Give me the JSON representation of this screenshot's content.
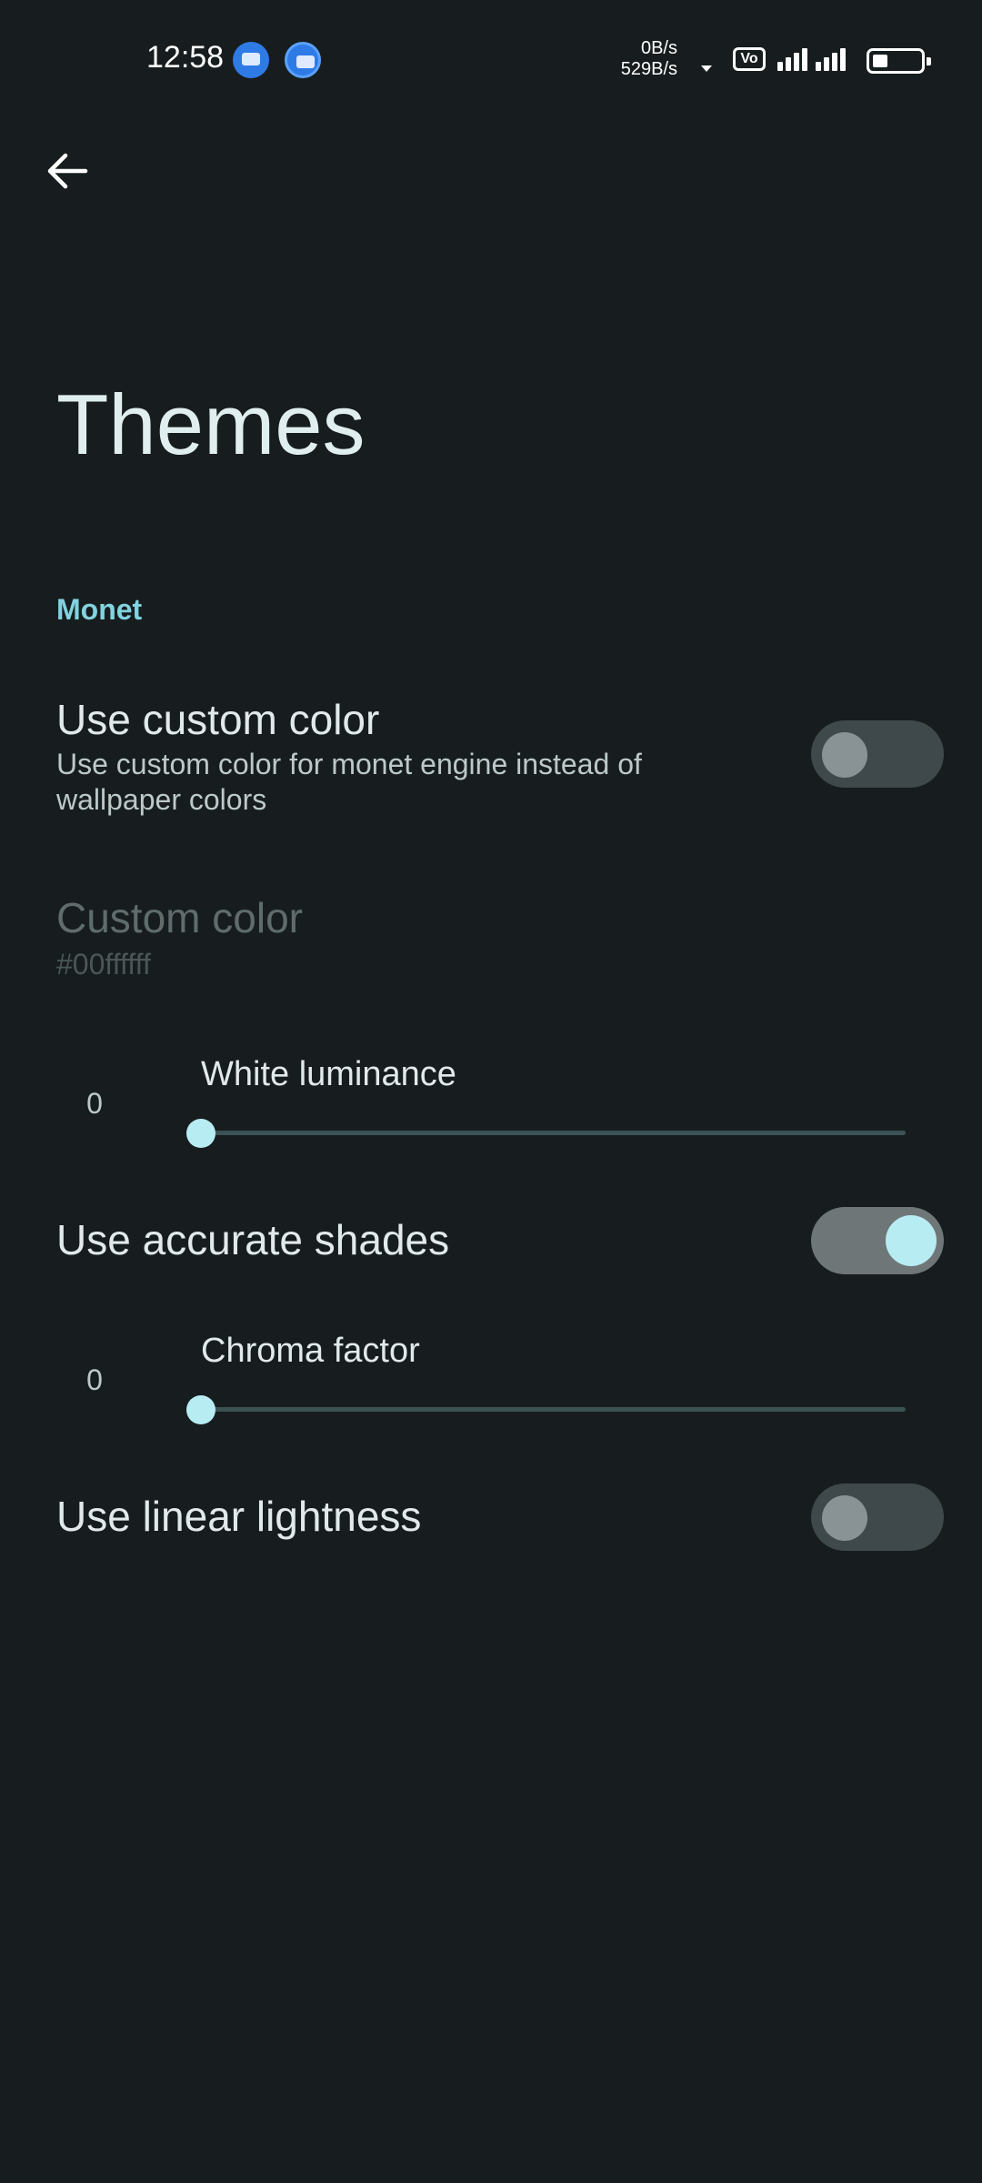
{
  "status_bar": {
    "time": "12:58",
    "net_up": "0B/s",
    "net_down": "529B/s",
    "volte": "Vo",
    "icons": [
      "message-notification-icon",
      "message-notification-icon",
      "wifi-activity-icon",
      "volte-icon",
      "signal-icon",
      "signal-icon",
      "battery-icon"
    ]
  },
  "app_bar": {
    "back_icon": "arrow-back-icon"
  },
  "page": {
    "title": "Themes"
  },
  "section": {
    "header": "Monet"
  },
  "prefs": {
    "use_custom_color": {
      "title": "Use custom color",
      "summary": "Use custom color for monet engine instead of wallpaper colors",
      "checked": false
    },
    "custom_color": {
      "title": "Custom color",
      "summary": "#00ffffff",
      "enabled": false
    },
    "white_luminance": {
      "label": "White luminance",
      "value_text": "0",
      "fraction": 0
    },
    "use_accurate_shades": {
      "title": "Use accurate shades",
      "checked": true
    },
    "chroma_factor": {
      "label": "Chroma factor",
      "value_text": "0",
      "fraction": 0
    },
    "use_linear_lightness": {
      "title": "Use linear lightness",
      "checked": false
    }
  },
  "colors": {
    "background": "#171d1e",
    "accent": "#82d3e0",
    "thumb_active": "#b8ecf3"
  }
}
